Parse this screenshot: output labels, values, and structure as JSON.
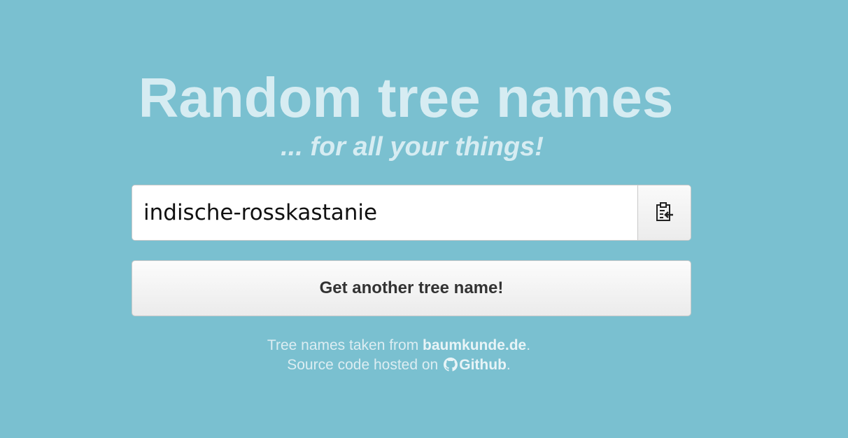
{
  "header": {
    "title": "Random tree names",
    "subtitle": "... for all your things!"
  },
  "generator": {
    "tree_name": "indische-rosskastanie",
    "copy_icon": "clipboard-icon",
    "get_button_label": "Get another tree name!"
  },
  "footer": {
    "line1_text": "Tree names taken from ",
    "line1_link": "baumkunde.de",
    "line1_end": ".",
    "line2_text": "Source code hosted on",
    "github_icon": "github-icon",
    "line2_link": "Github",
    "line2_end": "."
  },
  "colors": {
    "background": "#7ac0d0",
    "heading": "#d6ecf2"
  }
}
